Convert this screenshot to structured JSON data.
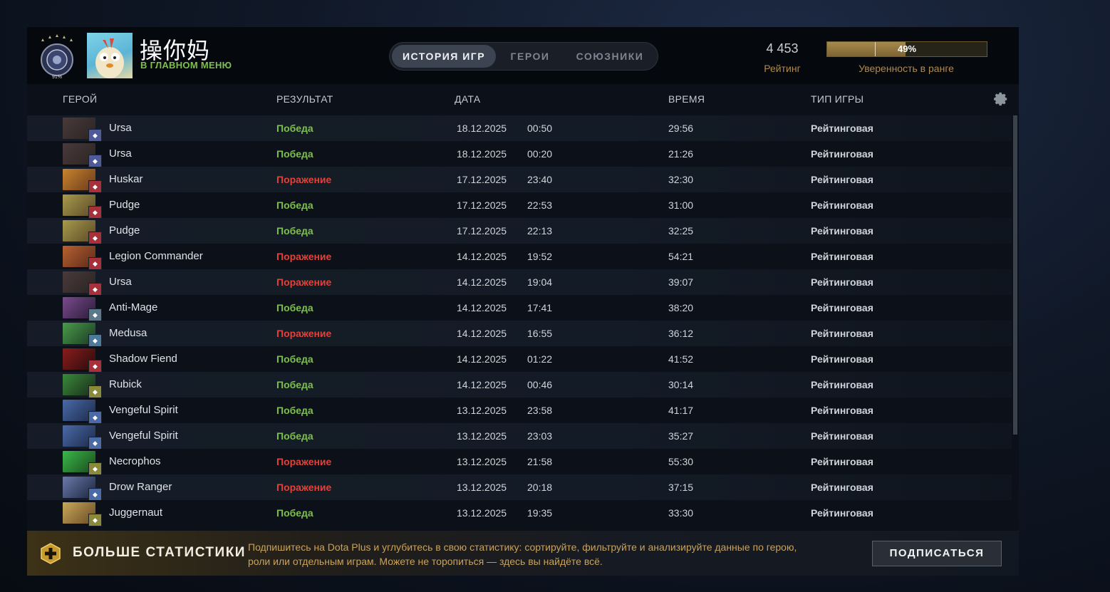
{
  "player": {
    "name": "操你妈",
    "status": "В ГЛАВНОМ МЕНЮ",
    "rank_medal_number": "91%"
  },
  "tabs": [
    {
      "label": "ИСТОРИЯ ИГР",
      "active": true
    },
    {
      "label": "ГЕРОИ",
      "active": false
    },
    {
      "label": "СОЮЗНИКИ",
      "active": false
    }
  ],
  "rating": {
    "value": "4 453",
    "label": "Рейтинг"
  },
  "confidence": {
    "percent_text": "49%",
    "fraction": 0.49,
    "label": "Уверенность в ранге"
  },
  "columns": {
    "hero": "ГЕРОЙ",
    "result": "РЕЗУЛЬТАТ",
    "date": "ДАТА",
    "duration": "ВРЕМЯ",
    "mode": "ТИП ИГРЫ"
  },
  "colors": {
    "win": "#7fbf4f",
    "loss": "#e1423a",
    "accent_gold": "#b08a4f"
  },
  "matches": [
    {
      "hero": "Ursa",
      "result": "Победа",
      "win": true,
      "date": "18.12.2025",
      "time": "00:50",
      "duration": "29:56",
      "mode": "Рейтинговая",
      "portrait": [
        "#4a3a3a",
        "#2a2424"
      ],
      "badge": "#4f5a9c"
    },
    {
      "hero": "Ursa",
      "result": "Победа",
      "win": true,
      "date": "18.12.2025",
      "time": "00:20",
      "duration": "21:26",
      "mode": "Рейтинговая",
      "portrait": [
        "#4a3a3a",
        "#2a2424"
      ],
      "badge": "#4f5a9c"
    },
    {
      "hero": "Huskar",
      "result": "Поражение",
      "win": false,
      "date": "17.12.2025",
      "time": "23:40",
      "duration": "32:30",
      "mode": "Рейтинговая",
      "portrait": [
        "#c8842e",
        "#6b3a1c"
      ],
      "badge": "#a8303a"
    },
    {
      "hero": "Pudge",
      "result": "Победа",
      "win": true,
      "date": "17.12.2025",
      "time": "22:53",
      "duration": "31:00",
      "mode": "Рейтинговая",
      "portrait": [
        "#a89a4c",
        "#5a4a28"
      ],
      "badge": "#a8303a"
    },
    {
      "hero": "Pudge",
      "result": "Победа",
      "win": true,
      "date": "17.12.2025",
      "time": "22:13",
      "duration": "32:25",
      "mode": "Рейтинговая",
      "portrait": [
        "#a89a4c",
        "#5a4a28"
      ],
      "badge": "#a8303a"
    },
    {
      "hero": "Legion Commander",
      "result": "Поражение",
      "win": false,
      "date": "14.12.2025",
      "time": "19:52",
      "duration": "54:21",
      "mode": "Рейтинговая",
      "portrait": [
        "#b8612e",
        "#5a2a1c"
      ],
      "badge": "#a8303a"
    },
    {
      "hero": "Ursa",
      "result": "Поражение",
      "win": false,
      "date": "14.12.2025",
      "time": "19:04",
      "duration": "39:07",
      "mode": "Рейтинговая",
      "portrait": [
        "#4a3a3a",
        "#2a2424"
      ],
      "badge": "#a8303a"
    },
    {
      "hero": "Anti-Mage",
      "result": "Победа",
      "win": true,
      "date": "14.12.2025",
      "time": "17:41",
      "duration": "38:20",
      "mode": "Рейтинговая",
      "portrait": [
        "#7a4a8c",
        "#2a1c3a"
      ],
      "badge": "#5a7a8c"
    },
    {
      "hero": "Medusa",
      "result": "Поражение",
      "win": false,
      "date": "14.12.2025",
      "time": "16:55",
      "duration": "36:12",
      "mode": "Рейтинговая",
      "portrait": [
        "#4a9a4a",
        "#1c3a24"
      ],
      "badge": "#4a7a9c"
    },
    {
      "hero": "Shadow Fiend",
      "result": "Победа",
      "win": true,
      "date": "14.12.2025",
      "time": "01:22",
      "duration": "41:52",
      "mode": "Рейтинговая",
      "portrait": [
        "#8a1c1c",
        "#2a0c0c"
      ],
      "badge": "#a8303a"
    },
    {
      "hero": "Rubick",
      "result": "Победа",
      "win": true,
      "date": "14.12.2025",
      "time": "00:46",
      "duration": "30:14",
      "mode": "Рейтинговая",
      "portrait": [
        "#3a8a3a",
        "#1a2a1a"
      ],
      "badge": "#8a8a3a"
    },
    {
      "hero": "Vengeful Spirit",
      "result": "Победа",
      "win": true,
      "date": "13.12.2025",
      "time": "23:58",
      "duration": "41:17",
      "mode": "Рейтинговая",
      "portrait": [
        "#4a6aa8",
        "#1c2a4a"
      ],
      "badge": "#4a6aa8"
    },
    {
      "hero": "Vengeful Spirit",
      "result": "Победа",
      "win": true,
      "date": "13.12.2025",
      "time": "23:03",
      "duration": "35:27",
      "mode": "Рейтинговая",
      "portrait": [
        "#4a6aa8",
        "#1c2a4a"
      ],
      "badge": "#4a6aa8"
    },
    {
      "hero": "Necrophos",
      "result": "Поражение",
      "win": false,
      "date": "13.12.2025",
      "time": "21:58",
      "duration": "55:30",
      "mode": "Рейтинговая",
      "portrait": [
        "#3ab84a",
        "#1a4a1c"
      ],
      "badge": "#8a8a3a"
    },
    {
      "hero": "Drow Ranger",
      "result": "Поражение",
      "win": false,
      "date": "13.12.2025",
      "time": "20:18",
      "duration": "37:15",
      "mode": "Рейтинговая",
      "portrait": [
        "#6a7aa8",
        "#1c2440"
      ],
      "badge": "#4a6aa8"
    },
    {
      "hero": "Juggernaut",
      "result": "Победа",
      "win": true,
      "date": "13.12.2025",
      "time": "19:35",
      "duration": "33:30",
      "mode": "Рейтинговая",
      "portrait": [
        "#c8a85a",
        "#6a4a24"
      ],
      "badge": "#8a8a3a"
    }
  ],
  "promo": {
    "title": "БОЛЬШЕ СТАТИСТИКИ",
    "text": "Подпишитесь на Dota Plus и углубитесь в свою статистику: сортируйте, фильтруйте и анализируйте данные по герою, роли или отдельным играм. Можете не торопиться — здесь вы найдёте всё.",
    "button": "ПОДПИСАТЬСЯ"
  }
}
